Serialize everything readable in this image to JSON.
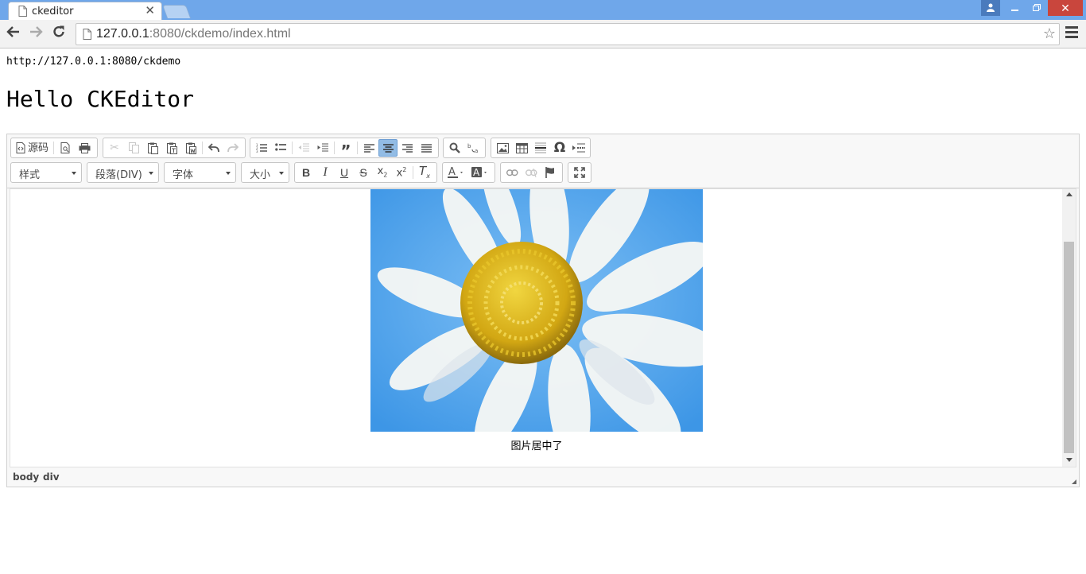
{
  "browser": {
    "tab_title": "ckeditor",
    "url_host": "127.0.0.1",
    "url_rest": ":8080/ckdemo/index.html"
  },
  "page": {
    "url_text": "http://127.0.0.1:8080/ckdemo",
    "heading": "Hello CKEditor"
  },
  "editor": {
    "toolbar_row1": {
      "source_label": "源码",
      "icons": [
        "source-icon",
        "preview-icon",
        "print-icon",
        "cut-icon",
        "copy-icon",
        "paste-icon",
        "paste-text-icon",
        "paste-word-icon",
        "undo-icon",
        "redo-icon",
        "numbered-list-icon",
        "bulleted-list-icon",
        "outdent-icon",
        "indent-icon",
        "blockquote-icon",
        "align-left-icon",
        "align-center-icon",
        "align-right-icon",
        "justify-icon",
        "find-icon",
        "replace-icon",
        "image-icon",
        "table-icon",
        "horizontal-line-icon",
        "special-char-icon",
        "page-break-icon"
      ]
    },
    "toolbar_row2": {
      "style_combo": "样式",
      "format_combo": "段落(DIV)",
      "font_combo": "字体",
      "size_combo": "大小"
    },
    "content": {
      "caption": "图片居中了"
    },
    "elements_path": [
      "body",
      "div"
    ],
    "colors": {
      "active_button": "#92bce5",
      "sky": "#4fa3ee",
      "flower_center": "#d9b21b"
    }
  }
}
